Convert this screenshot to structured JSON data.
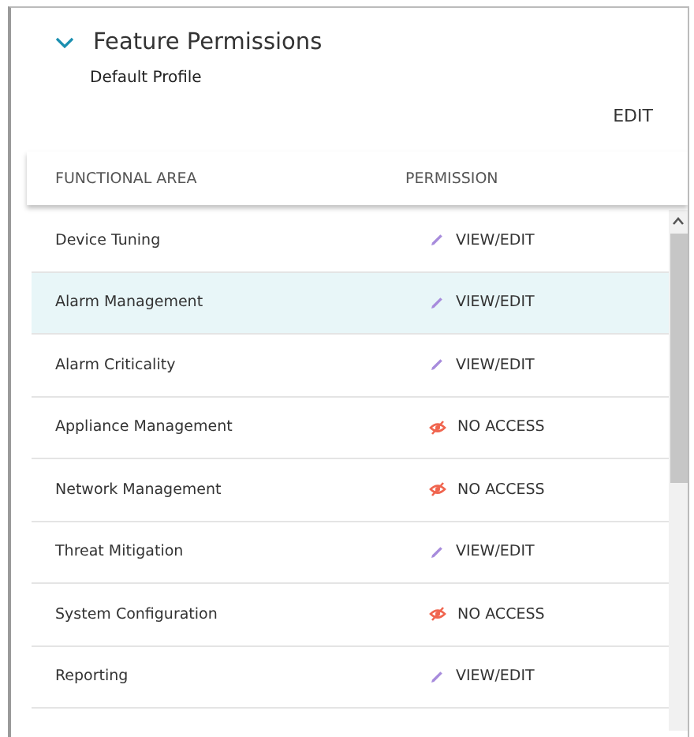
{
  "section": {
    "title": "Feature Permissions",
    "expanded": true,
    "subtitle": "Default Profile",
    "action": "EDIT"
  },
  "table": {
    "columns": [
      "FUNCTIONAL AREA",
      "PERMISSION"
    ],
    "rows": [
      {
        "area": "Device Tuning",
        "permission": "VIEW/EDIT",
        "kind": "view_edit",
        "selected": false
      },
      {
        "area": "Alarm Management",
        "permission": "VIEW/EDIT",
        "kind": "view_edit",
        "selected": true
      },
      {
        "area": "Alarm Criticality",
        "permission": "VIEW/EDIT",
        "kind": "view_edit",
        "selected": false
      },
      {
        "area": "Appliance Management",
        "permission": "NO ACCESS",
        "kind": "no_access",
        "selected": false
      },
      {
        "area": "Network Management",
        "permission": "NO ACCESS",
        "kind": "no_access",
        "selected": false
      },
      {
        "area": "Threat Mitigation",
        "permission": "VIEW/EDIT",
        "kind": "view_edit",
        "selected": false
      },
      {
        "area": "System Configuration",
        "permission": "NO ACCESS",
        "kind": "no_access",
        "selected": false
      },
      {
        "area": "Reporting",
        "permission": "VIEW/EDIT",
        "kind": "view_edit",
        "selected": false
      }
    ]
  }
}
